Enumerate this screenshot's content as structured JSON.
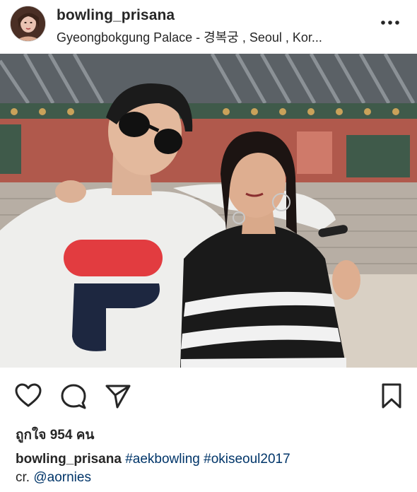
{
  "post": {
    "username": "bowling_prisana",
    "location": "Gyeongbokgung Palace - 경복궁 , Seoul , Kor..."
  },
  "icons": {
    "more": "more-options-icon",
    "like": "heart-icon",
    "comment": "comment-bubble-icon",
    "share": "paper-plane-icon",
    "save": "bookmark-icon"
  },
  "likes": {
    "prefix": "ถูกใจ",
    "count": "954",
    "suffix": "คน"
  },
  "caption": {
    "username": "bowling_prisana",
    "hashtags": [
      "#aekbowling",
      "#okiseoul2017"
    ],
    "credit_prefix": "cr.",
    "credit_mention": "@aornies"
  },
  "colors": {
    "text": "#262626",
    "hashtag": "#003569",
    "divider": "#dbdbdb"
  }
}
